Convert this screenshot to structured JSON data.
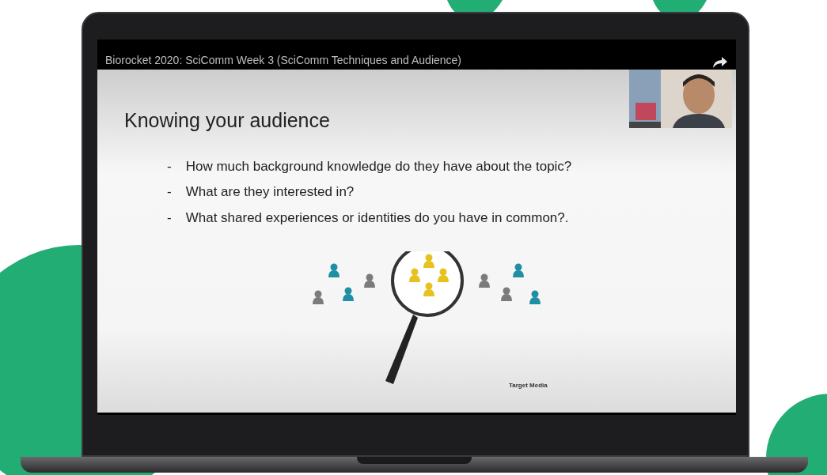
{
  "video": {
    "title": "Biorocket 2020: SciComm Week 3 (SciComm Techniques and Audience)"
  },
  "slide": {
    "heading": "Knowing your audience",
    "bullet_mark": "-",
    "bullets": [
      "How much background knowledge do they have about the topic?",
      "What are they interested in?",
      "What shared experiences or identities do you have in common?."
    ],
    "logo_text": "Target Media"
  }
}
